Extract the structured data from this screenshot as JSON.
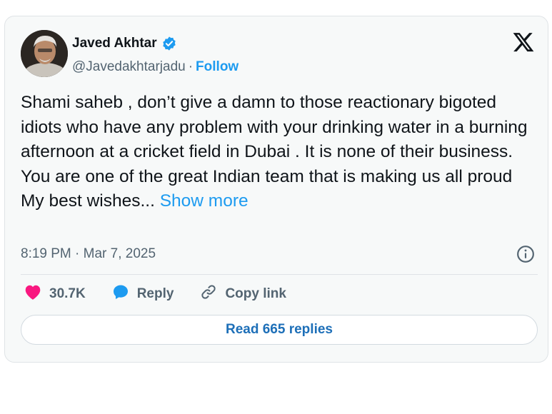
{
  "author": {
    "name": "Javed Akhtar",
    "handle": "@Javedakhtarjadu",
    "separator": "·",
    "follow_label": "Follow",
    "verified_color": "#1d9bf0"
  },
  "tweet": {
    "text": "Shami saheb , don’t give a damn to those reactionary bigoted idiots who have any problem with your drinking water in a burning  afternoon at a cricket  field in Dubai . It is none of their business. You are one of the great Indian team that is making us all proud My best wishes...",
    "show_more_label": "Show more",
    "timestamp": "8:19 PM · Mar 7, 2025"
  },
  "actions": {
    "likes_count": "30.7K",
    "reply_label": "Reply",
    "copy_link_label": "Copy link"
  },
  "footer": {
    "read_replies_label": "Read 665 replies"
  },
  "colors": {
    "accent": "#1d9bf0",
    "heart": "#f91880",
    "text": "#0f1419",
    "muted": "#536471"
  },
  "icons": [
    "verified-badge-icon",
    "x-logo-icon",
    "info-icon",
    "heart-icon",
    "reply-bubble-icon",
    "link-icon"
  ]
}
